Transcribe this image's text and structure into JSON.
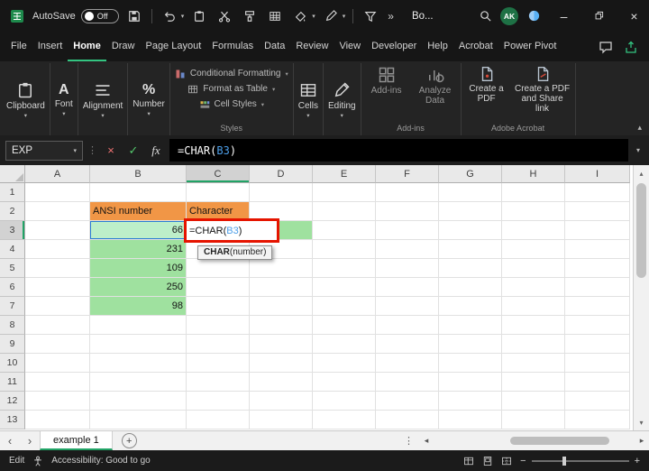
{
  "colors": {
    "excel_green": "#21A366",
    "tab_accent_green": "#33C481",
    "fill_orange": "#F19646",
    "fill_green": "#9FE19F",
    "fill_green_light": "#BDEFC9",
    "reference_blue": "#2B7CD3",
    "annotation_red": "#E51400"
  },
  "icons": {
    "chevron_down": "▾",
    "chevron_up": "▴",
    "more_commands": "»",
    "minimize": "–",
    "close": "×",
    "check": "✓",
    "cancel": "×",
    "fx": "fx",
    "tab_prev": "‹",
    "tab_next": "›",
    "scroll_left": "◂",
    "scroll_right": "▸",
    "scroll_up": "▴",
    "scroll_down": "▾",
    "plus": "+",
    "minus": "−",
    "vdots": "⋮",
    "font_glyph": "A",
    "percent_glyph": "%"
  },
  "titlebar": {
    "autosave_label": "AutoSave",
    "autosave_state": "Off",
    "workbook_title": "Bo...",
    "avatar_initials": "AK"
  },
  "menubar": {
    "items": [
      "File",
      "Insert",
      "Home",
      "Draw",
      "Page Layout",
      "Formulas",
      "Data",
      "Review",
      "View",
      "Developer",
      "Help",
      "Acrobat",
      "Power Pivot"
    ],
    "active": "Home"
  },
  "ribbon": {
    "clipboard": "Clipboard",
    "font": "Font",
    "alignment": "Alignment",
    "number": "Number",
    "styles_items": [
      "Conditional Formatting",
      "Format as Table",
      "Cell Styles"
    ],
    "styles_label": "Styles",
    "cells": "Cells",
    "editing": "Editing",
    "addins_button": "Add-ins",
    "analyze_data": "Analyze Data",
    "addins_label": "Add-ins",
    "create_pdf": "Create a PDF",
    "create_pdf_share": "Create a PDF and Share link",
    "acrobat_label": "Adobe Acrobat"
  },
  "formula_bar": {
    "name_box": "EXP",
    "prefix": "=CHAR(",
    "ref": "B3",
    "suffix": ")"
  },
  "grid": {
    "col_headers": [
      "A",
      "B",
      "C",
      "D",
      "E",
      "F",
      "G",
      "H",
      "I"
    ],
    "row_count": 13,
    "active_col": "C",
    "active_row": "3",
    "cells": [
      {
        "ref": "B2",
        "text": "ANSI number",
        "cls": "fill-orange"
      },
      {
        "ref": "C2",
        "text": "Character",
        "cls": "fill-orange"
      },
      {
        "ref": "B3",
        "text": "66",
        "cls": "fill-green-light num"
      },
      {
        "ref": "D3",
        "text": "",
        "cls": "fill-green"
      },
      {
        "ref": "B4",
        "text": "231",
        "cls": "fill-green num"
      },
      {
        "ref": "B5",
        "text": "109",
        "cls": "fill-green num"
      },
      {
        "ref": "B6",
        "text": "250",
        "cls": "fill-green num"
      },
      {
        "ref": "B7",
        "text": "98",
        "cls": "fill-green num"
      }
    ]
  },
  "function_tooltip": {
    "name": "CHAR",
    "args": "(number)"
  },
  "sheet_tabs": {
    "active": "example 1"
  },
  "status_bar": {
    "mode": "Edit",
    "accessibility": "Accessibility: Good to go"
  }
}
